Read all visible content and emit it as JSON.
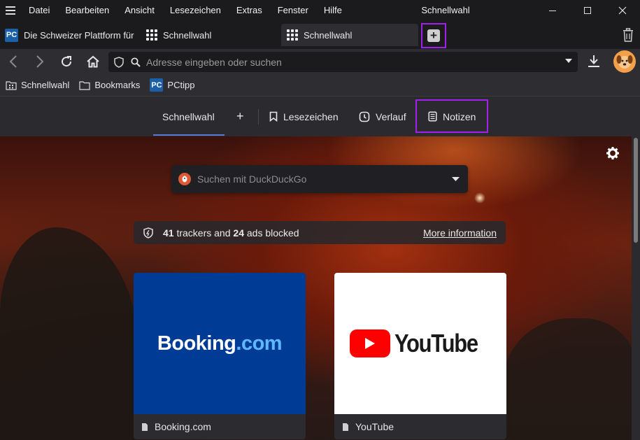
{
  "titlebar": {
    "menu": [
      "Datei",
      "Bearbeiten",
      "Ansicht",
      "Lesezeichen",
      "Extras",
      "Fenster",
      "Hilfe"
    ],
    "title": "Schnellwahl"
  },
  "tabs": [
    {
      "label": "Die Schweizer Plattform für",
      "icon": "pctipp-logo",
      "active": false
    },
    {
      "label": "Schnellwahl",
      "icon": "grid-icon",
      "active": false
    },
    {
      "label": "Schnellwahl",
      "icon": "grid-icon",
      "active": true
    }
  ],
  "pc_logo_text": "PC",
  "address": {
    "placeholder": "Adresse eingeben oder suchen"
  },
  "bookmarks": [
    {
      "label": "Schnellwahl",
      "icon": "speed-dial-folder-icon"
    },
    {
      "label": "Bookmarks",
      "icon": "folder-icon"
    },
    {
      "label": "PCtipp",
      "icon": "pctipp-logo"
    }
  ],
  "startpage": {
    "tabs": {
      "speeddial": "Schnellwahl",
      "add": "+",
      "bookmarks": "Lesezeichen",
      "history": "Verlauf",
      "notes": "Notizen"
    },
    "search_placeholder": "Suchen mit DuckDuckGo",
    "tracker": {
      "trackers": "41",
      "trackers_text": "trackers and",
      "ads": "24",
      "ads_text": "ads blocked",
      "link": "More information"
    },
    "tiles": [
      {
        "title": "Booking.com",
        "logo_main": "Booking",
        "logo_suffix": ".com"
      },
      {
        "title": "YouTube",
        "logo_text": "YouTube"
      }
    ]
  },
  "colors": {
    "highlight": "#a020f0",
    "accent": "#5a7ad6",
    "booking": "#003b95",
    "youtube_red": "#ff0000"
  }
}
